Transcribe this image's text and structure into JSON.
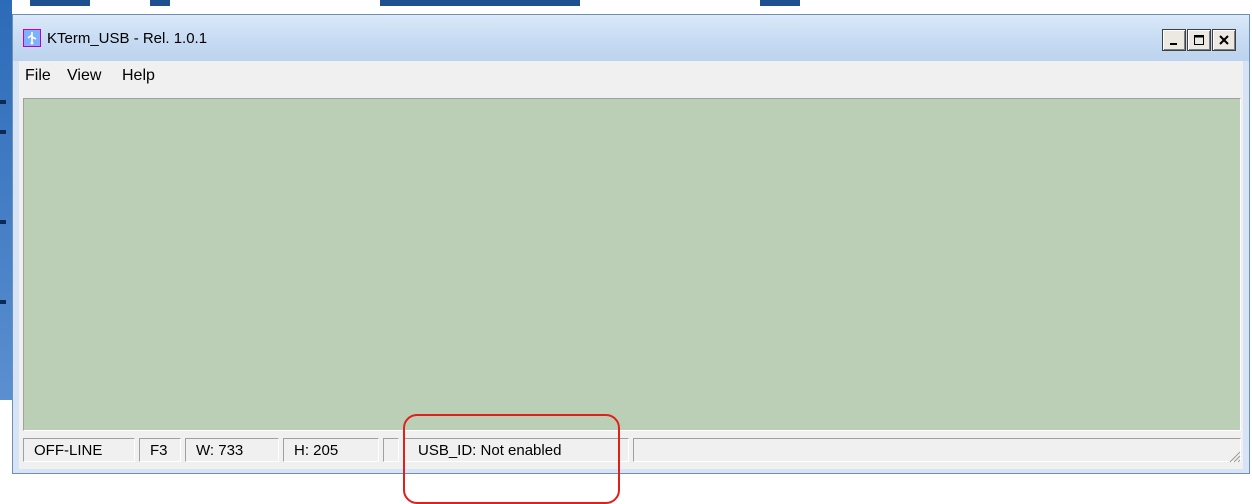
{
  "window": {
    "title": "KTerm_USB - Rel. 1.0.1",
    "buttons": {
      "minimize_icon": "minimize-icon",
      "maximize_icon": "maximize-icon",
      "close_icon": "close-icon"
    }
  },
  "menu": {
    "items": [
      "File",
      "View",
      "Help"
    ]
  },
  "terminal": {
    "background": "#bbcfb7"
  },
  "status": {
    "mode": "OFF-LINE",
    "font": "F3",
    "width": "W:  733",
    "height": "H:  205",
    "usb_id": "USB_ID: Not enabled"
  },
  "colors": {
    "highlight": "#e0201a",
    "titlebar": "#c8dcf3",
    "accent": "#3a6ea5"
  }
}
